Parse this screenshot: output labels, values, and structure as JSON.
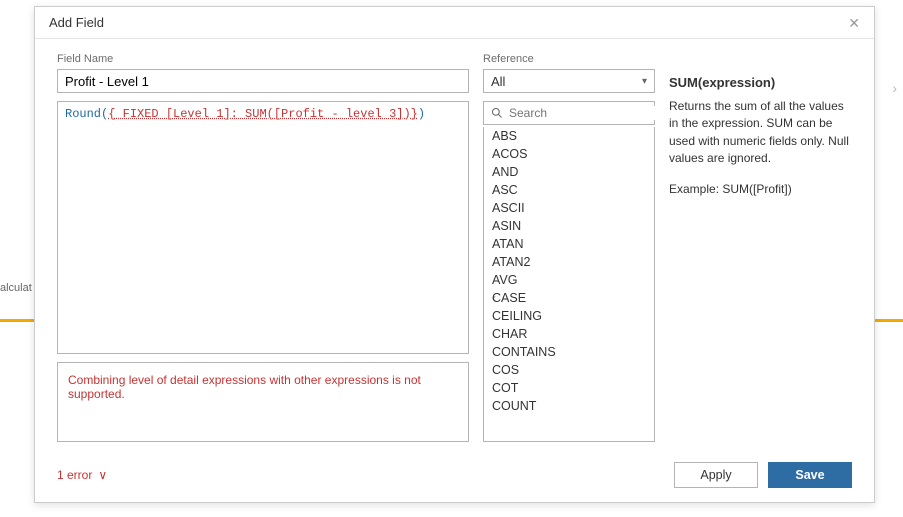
{
  "dialog": {
    "title": "Add Field"
  },
  "fieldName": {
    "label": "Field Name",
    "value": "Profit - Level 1"
  },
  "formula": {
    "fn": "Round",
    "err_inner": "{ FIXED [Level 1]: SUM([Profit - level 3])}"
  },
  "errorBox": {
    "text": "Combining level of detail expressions with other expressions is not supported."
  },
  "reference": {
    "label": "Reference",
    "selected": "All",
    "search_placeholder": "Search",
    "items": [
      "ABS",
      "ACOS",
      "AND",
      "ASC",
      "ASCII",
      "ASIN",
      "ATAN",
      "ATAN2",
      "AVG",
      "CASE",
      "CEILING",
      "CHAR",
      "CONTAINS",
      "COS",
      "COT",
      "COUNT"
    ]
  },
  "help": {
    "title": "SUM(expression)",
    "desc": "Returns the sum of all the values in the expression. SUM can be used with numeric fields only. Null values are ignored.",
    "example": "Example: SUM([Profit])"
  },
  "footer": {
    "error_count": "1 error",
    "apply": "Apply",
    "save": "Save"
  },
  "bg": {
    "partial": "alculat"
  }
}
